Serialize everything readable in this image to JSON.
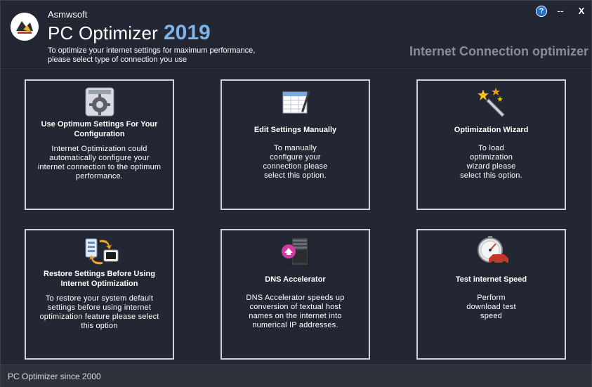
{
  "header": {
    "vendor": "Asmwsoft",
    "app_name": "PC Optimizer",
    "app_year": "2019",
    "instructions_line1": "To optimize your internet settings for maximum performance,",
    "instructions_line2": "please select type of connection you use",
    "section_title": "Internet Connection optimizer"
  },
  "window_controls": {
    "help": "?",
    "minimize": "--",
    "close": "X"
  },
  "cards": [
    {
      "title_line1": "Use Optimum Settings For Your",
      "title_line2": "Configuration",
      "desc": [
        "Internet Optimization could",
        "automatically configure your",
        "internet connection to the optimum",
        "performance."
      ],
      "icon": "gear-settings-icon"
    },
    {
      "title_line1": "Edit Settings Manually",
      "desc": [
        "To manually",
        "configure your",
        "connection please",
        "select this option."
      ],
      "icon": "spreadsheet-pen-icon"
    },
    {
      "title_line1": "Optimization Wizard",
      "desc": [
        "To load",
        "optimization",
        "wizard please",
        "select this option."
      ],
      "icon": "magic-wand-icon"
    },
    {
      "title_line1": "Restore Settings Before Using",
      "title_line2": "Internet Optimization",
      "desc": [
        "To restore your system default",
        "settings before using internet",
        "optimization feature please select",
        "this option"
      ],
      "icon": "restore-arrows-icon"
    },
    {
      "title_line1": "DNS Accelerator",
      "desc": [
        "DNS Accelerator speeds up",
        "conversion of textual host",
        "names on the internet into",
        "numerical IP addresses."
      ],
      "icon": "server-icon"
    },
    {
      "title_line1": "Test internet Speed",
      "desc": [
        "Perform",
        "download test",
        "speed"
      ],
      "icon": "speedometer-car-icon"
    }
  ],
  "status": {
    "text": "PC Optimizer since 2000"
  },
  "colors": {
    "background": "#232733",
    "accent_year": "#7fb3e8",
    "card_border": "#cfd2d8",
    "section_title": "#8a8d95"
  }
}
